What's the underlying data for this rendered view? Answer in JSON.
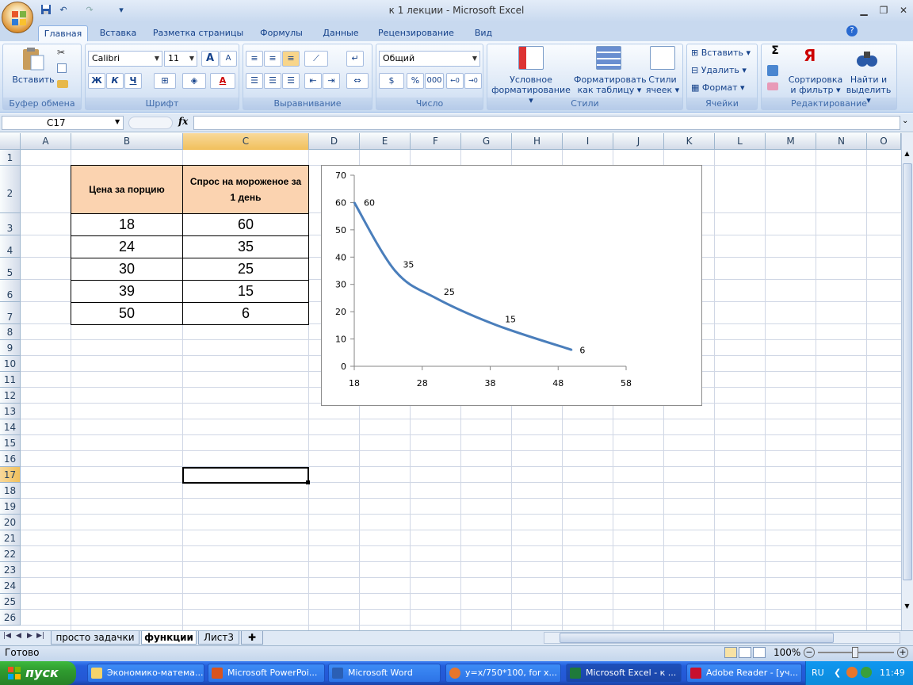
{
  "window": {
    "title": "к 1 лекции - Microsoft Excel",
    "min": "▁",
    "restore": "❐",
    "close": "✕"
  },
  "quick_access": {
    "save_icon": "save-icon",
    "undo_icon": "undo-icon",
    "redo_icon": "redo-icon"
  },
  "ribbon_tabs": [
    "Главная",
    "Вставка",
    "Разметка страницы",
    "Формулы",
    "Данные",
    "Рецензирование",
    "Вид"
  ],
  "ribbon": {
    "clipboard": {
      "paste": "Вставить",
      "label": "Буфер обмена"
    },
    "font": {
      "name": "Calibri",
      "size": "11",
      "bold": "Ж",
      "italic": "К",
      "underline": "Ч",
      "grow": "A",
      "shrink": "A",
      "color_letter": "A",
      "label": "Шрифт"
    },
    "alignment": {
      "label": "Выравнивание"
    },
    "number": {
      "format": "Общий",
      "percent": "%",
      "thousands": "000",
      "label": "Число"
    },
    "styles": {
      "cond": "Условное",
      "cond2": "форматирование",
      "table": "Форматировать",
      "table2": "как таблицу",
      "cell": "Стили",
      "cell2": "ячеек",
      "label": "Стили"
    },
    "cells": {
      "insert": "Вставить",
      "delete": "Удалить",
      "format": "Формат",
      "label": "Ячейки"
    },
    "editing": {
      "sigma": "Σ",
      "sort": "Сортировка",
      "sort2": "и фильтр",
      "find": "Найти и",
      "find2": "выделить",
      "label": "Редактирование"
    }
  },
  "formula_bar": {
    "name_box": "C17",
    "fx": "fx",
    "content": ""
  },
  "columns": [
    "A",
    "B",
    "C",
    "D",
    "E",
    "F",
    "G",
    "H",
    "I",
    "J",
    "K",
    "L",
    "M",
    "N",
    "O"
  ],
  "rows": [
    "1",
    "2",
    "3",
    "4",
    "5",
    "6",
    "7",
    "8",
    "9",
    "10",
    "11",
    "12",
    "13",
    "14",
    "15",
    "16",
    "17",
    "18",
    "19",
    "20",
    "21",
    "22",
    "23",
    "24",
    "25",
    "26"
  ],
  "table": {
    "header_price": "Цена за порцию",
    "header_demand_1": "Спрос на мороженое за",
    "header_demand_2": "1 день",
    "prices": [
      "18",
      "24",
      "30",
      "39",
      "50"
    ],
    "demand": [
      "60",
      "35",
      "25",
      "15",
      "6"
    ]
  },
  "chart_data": {
    "type": "scatter",
    "smooth_line": true,
    "x": [
      18,
      24,
      30,
      39,
      50
    ],
    "y": [
      60,
      35,
      25,
      15,
      6
    ],
    "data_labels": [
      "60",
      "35",
      "25",
      "15",
      "6"
    ],
    "xlim": [
      18,
      58
    ],
    "ylim": [
      0,
      70
    ],
    "x_ticks": [
      "18",
      "28",
      "38",
      "48",
      "58"
    ],
    "y_ticks": [
      "0",
      "10",
      "20",
      "30",
      "40",
      "50",
      "60",
      "70"
    ],
    "series_color": "#4a7ebb",
    "title": "",
    "xlabel": "",
    "ylabel": "",
    "legend": "none",
    "grid": false
  },
  "sheet_tabs": [
    "просто задачки",
    "функции",
    "Лист3"
  ],
  "status": {
    "ready": "Готово",
    "zoom": "100%"
  },
  "taskbar": {
    "start": "пуск",
    "tasks": [
      "Экономико-матема...",
      "Microsoft PowerPoi...",
      "Microsoft Word",
      "y=x/750*100, for x...",
      "Microsoft Excel - к ...",
      "Adobe Reader - [уч..."
    ],
    "lang": "RU",
    "time": "11:49"
  },
  "colors": {
    "header_fill": "#fbd3b0",
    "selected_col": "#f1c05b",
    "taskbar": "#245edb",
    "start": "#2f9b2f"
  }
}
